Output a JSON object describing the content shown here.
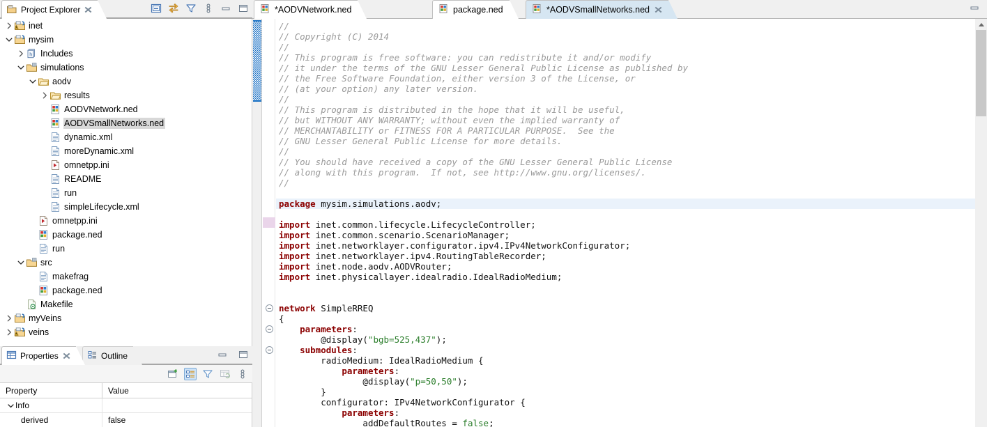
{
  "project_explorer": {
    "tab_label": "Project Explorer",
    "icon": "project-explorer-icon",
    "toolbar": [
      {
        "name": "collapse-all-icon",
        "tooltip": "Collapse All"
      },
      {
        "name": "link-with-editor-icon",
        "tooltip": "Link with Editor"
      },
      {
        "name": "filter-icon",
        "tooltip": "Filters"
      },
      {
        "name": "view-menu-icon",
        "tooltip": "View Menu"
      },
      {
        "name": "minimize-icon",
        "tooltip": "Minimize"
      },
      {
        "name": "maximize-icon",
        "tooltip": "Maximize"
      }
    ],
    "tree": [
      {
        "label": "inet",
        "indent": 0,
        "arrow": "collapsed",
        "icon": "project-warning-icon",
        "selected": false
      },
      {
        "label": "mysim",
        "indent": 0,
        "arrow": "expanded",
        "icon": "project-icon",
        "selected": false
      },
      {
        "label": "Includes",
        "indent": 1,
        "arrow": "collapsed",
        "icon": "includes-icon",
        "selected": false
      },
      {
        "label": "simulations",
        "indent": 1,
        "arrow": "expanded",
        "icon": "source-folder-icon",
        "selected": false
      },
      {
        "label": "aodv",
        "indent": 2,
        "arrow": "expanded",
        "icon": "folder-icon",
        "selected": false
      },
      {
        "label": "results",
        "indent": 3,
        "arrow": "collapsed",
        "icon": "folder-icon",
        "selected": false
      },
      {
        "label": "AODVNetwork.ned",
        "indent": 3,
        "arrow": "none",
        "icon": "ned-file-icon",
        "selected": false
      },
      {
        "label": "AODVSmallNetworks.ned",
        "indent": 3,
        "arrow": "none",
        "icon": "ned-file-icon",
        "selected": true
      },
      {
        "label": "dynamic.xml",
        "indent": 3,
        "arrow": "none",
        "icon": "xml-file-icon",
        "selected": false
      },
      {
        "label": "moreDynamic.xml",
        "indent": 3,
        "arrow": "none",
        "icon": "xml-file-icon",
        "selected": false
      },
      {
        "label": "omnetpp.ini",
        "indent": 3,
        "arrow": "none",
        "icon": "ini-file-icon",
        "selected": false
      },
      {
        "label": "README",
        "indent": 3,
        "arrow": "none",
        "icon": "text-file-icon",
        "selected": false
      },
      {
        "label": "run",
        "indent": 3,
        "arrow": "none",
        "icon": "text-file-icon",
        "selected": false
      },
      {
        "label": "simpleLifecycle.xml",
        "indent": 3,
        "arrow": "none",
        "icon": "xml-file-icon",
        "selected": false
      },
      {
        "label": "omnetpp.ini",
        "indent": 2,
        "arrow": "none",
        "icon": "ini-file-icon",
        "selected": false
      },
      {
        "label": "package.ned",
        "indent": 2,
        "arrow": "none",
        "icon": "ned-file-icon",
        "selected": false
      },
      {
        "label": "run",
        "indent": 2,
        "arrow": "none",
        "icon": "text-file-icon",
        "selected": false
      },
      {
        "label": "src",
        "indent": 1,
        "arrow": "expanded",
        "icon": "source-folder-icon",
        "selected": false
      },
      {
        "label": "makefrag",
        "indent": 2,
        "arrow": "none",
        "icon": "text-file-icon",
        "selected": false
      },
      {
        "label": "package.ned",
        "indent": 2,
        "arrow": "none",
        "icon": "ned-file-icon",
        "selected": false
      },
      {
        "label": "Makefile",
        "indent": 1,
        "arrow": "none",
        "icon": "makefile-icon",
        "selected": false
      },
      {
        "label": "myVeins",
        "indent": 0,
        "arrow": "collapsed",
        "icon": "project-icon",
        "selected": false
      },
      {
        "label": "veins",
        "indent": 0,
        "arrow": "collapsed",
        "icon": "project-warning-icon",
        "selected": false
      }
    ]
  },
  "properties_view": {
    "tabs": [
      {
        "label": "Properties",
        "icon": "properties-icon",
        "active": true,
        "closable": true
      },
      {
        "label": "Outline",
        "icon": "outline-icon",
        "active": false,
        "closable": false
      }
    ],
    "toolbar": [
      {
        "name": "new-property-icon",
        "selected": false
      },
      {
        "name": "show-categories-icon",
        "selected": true
      },
      {
        "name": "filter-icon",
        "selected": false
      },
      {
        "name": "restore-default-icon",
        "selected": false
      },
      {
        "name": "view-menu-icon",
        "selected": false
      }
    ],
    "window_buttons": [
      {
        "name": "minimize-icon"
      },
      {
        "name": "maximize-icon"
      }
    ],
    "columns": [
      "Property",
      "Value"
    ],
    "rows": [
      {
        "property": "Info",
        "value": "",
        "group": true,
        "expanded": true
      },
      {
        "property": "derived",
        "value": "false",
        "group": false
      }
    ]
  },
  "editor": {
    "tabs": [
      {
        "label": "*AODVNetwork.ned",
        "icon": "ned-file-icon",
        "active": false,
        "closable": false,
        "dirty": true
      },
      {
        "label": "package.ned",
        "icon": "ned-file-icon",
        "active": false,
        "closable": false,
        "dirty": false
      },
      {
        "label": "*AODVSmallNetworks.ned",
        "icon": "ned-file-icon",
        "active": true,
        "closable": true,
        "dirty": true
      }
    ],
    "window_buttons": [
      {
        "name": "minimize-icon"
      }
    ],
    "scrollbar": {
      "name": "editor-vertical-scrollbar",
      "thumb_top_pct": 3,
      "thumb_height_pct": 21
    },
    "code_lines": [
      {
        "indent": 0,
        "tokens": [
          {
            "t": "//",
            "c": "cmt"
          }
        ],
        "fold": null,
        "highlight": false
      },
      {
        "indent": 0,
        "tokens": [
          {
            "t": "// Copyright (C) 2014",
            "c": "cmt"
          }
        ],
        "fold": null,
        "highlight": false
      },
      {
        "indent": 0,
        "tokens": [
          {
            "t": "//",
            "c": "cmt"
          }
        ],
        "fold": null,
        "highlight": false
      },
      {
        "indent": 0,
        "tokens": [
          {
            "t": "// This program is free software: you can redistribute it and/or modify",
            "c": "cmt"
          }
        ],
        "fold": null,
        "highlight": false
      },
      {
        "indent": 0,
        "tokens": [
          {
            "t": "// it under the terms of the GNU Lesser General Public License as published by",
            "c": "cmt"
          }
        ],
        "fold": null,
        "highlight": false
      },
      {
        "indent": 0,
        "tokens": [
          {
            "t": "// the Free Software Foundation, either version 3 of the License, or",
            "c": "cmt"
          }
        ],
        "fold": null,
        "highlight": false
      },
      {
        "indent": 0,
        "tokens": [
          {
            "t": "// (at your option) any later version.",
            "c": "cmt"
          }
        ],
        "fold": null,
        "highlight": false
      },
      {
        "indent": 0,
        "tokens": [
          {
            "t": "//",
            "c": "cmt"
          }
        ],
        "fold": null,
        "highlight": false
      },
      {
        "indent": 0,
        "tokens": [
          {
            "t": "// This program is distributed in the hope that it will be useful,",
            "c": "cmt"
          }
        ],
        "fold": null,
        "highlight": false
      },
      {
        "indent": 0,
        "tokens": [
          {
            "t": "// but WITHOUT ANY WARRANTY; without even the implied warranty of",
            "c": "cmt"
          }
        ],
        "fold": null,
        "highlight": false
      },
      {
        "indent": 0,
        "tokens": [
          {
            "t": "// MERCHANTABILITY or FITNESS FOR A PARTICULAR PURPOSE.  See the",
            "c": "cmt"
          }
        ],
        "fold": null,
        "highlight": false
      },
      {
        "indent": 0,
        "tokens": [
          {
            "t": "// GNU Lesser General Public License for more details.",
            "c": "cmt"
          }
        ],
        "fold": null,
        "highlight": false
      },
      {
        "indent": 0,
        "tokens": [
          {
            "t": "//",
            "c": "cmt"
          }
        ],
        "fold": null,
        "highlight": false
      },
      {
        "indent": 0,
        "tokens": [
          {
            "t": "// You should have received a copy of the GNU Lesser General Public License",
            "c": "cmt"
          }
        ],
        "fold": null,
        "highlight": false
      },
      {
        "indent": 0,
        "tokens": [
          {
            "t": "// along with this program.  If not, see http://www.gnu.org/licenses/.",
            "c": "cmt"
          }
        ],
        "fold": null,
        "highlight": false
      },
      {
        "indent": 0,
        "tokens": [
          {
            "t": "//",
            "c": "cmt"
          }
        ],
        "fold": null,
        "highlight": false
      },
      {
        "indent": 0,
        "tokens": [],
        "fold": null,
        "highlight": false
      },
      {
        "indent": 0,
        "tokens": [
          {
            "t": "package",
            "c": "kw"
          },
          {
            "t": " mysim.simulations.aodv;",
            "c": "pln"
          }
        ],
        "fold": null,
        "highlight": true
      },
      {
        "indent": 0,
        "tokens": [],
        "fold": null,
        "highlight": false
      },
      {
        "indent": 0,
        "tokens": [
          {
            "t": "import",
            "c": "kw"
          },
          {
            "t": " inet.common.lifecycle.LifecycleController;",
            "c": "pln"
          }
        ],
        "fold": null,
        "highlight": false
      },
      {
        "indent": 0,
        "tokens": [
          {
            "t": "import",
            "c": "kw"
          },
          {
            "t": " inet.common.scenario.ScenarioManager;",
            "c": "pln"
          }
        ],
        "fold": null,
        "highlight": false
      },
      {
        "indent": 0,
        "tokens": [
          {
            "t": "import",
            "c": "kw"
          },
          {
            "t": " inet.networklayer.configurator.ipv4.IPv4NetworkConfigurator;",
            "c": "pln"
          }
        ],
        "fold": null,
        "highlight": false
      },
      {
        "indent": 0,
        "tokens": [
          {
            "t": "import",
            "c": "kw"
          },
          {
            "t": " inet.networklayer.ipv4.RoutingTableRecorder;",
            "c": "pln"
          }
        ],
        "fold": null,
        "highlight": false
      },
      {
        "indent": 0,
        "tokens": [
          {
            "t": "import",
            "c": "kw"
          },
          {
            "t": " inet.node.aodv.AODVRouter;",
            "c": "pln"
          }
        ],
        "fold": null,
        "highlight": false
      },
      {
        "indent": 0,
        "tokens": [
          {
            "t": "import",
            "c": "kw"
          },
          {
            "t": " inet.physicallayer.idealradio.IdealRadioMedium;",
            "c": "pln"
          }
        ],
        "fold": null,
        "highlight": false
      },
      {
        "indent": 0,
        "tokens": [],
        "fold": null,
        "highlight": false
      },
      {
        "indent": 0,
        "tokens": [],
        "fold": null,
        "highlight": false
      },
      {
        "indent": 0,
        "tokens": [
          {
            "t": "network",
            "c": "kw"
          },
          {
            "t": " SimpleRREQ",
            "c": "pln"
          }
        ],
        "fold": "collapse",
        "highlight": false
      },
      {
        "indent": 0,
        "tokens": [
          {
            "t": "{",
            "c": "pln"
          }
        ],
        "fold": null,
        "highlight": false
      },
      {
        "indent": 1,
        "tokens": [
          {
            "t": "parameters",
            "c": "kw"
          },
          {
            "t": ":",
            "c": "pln"
          }
        ],
        "fold": "collapse",
        "highlight": false
      },
      {
        "indent": 2,
        "tokens": [
          {
            "t": "@display(",
            "c": "pln"
          },
          {
            "t": "\"bgb=525,437\"",
            "c": "str"
          },
          {
            "t": ");",
            "c": "pln"
          }
        ],
        "fold": null,
        "highlight": false
      },
      {
        "indent": 1,
        "tokens": [
          {
            "t": "submodules",
            "c": "kw"
          },
          {
            "t": ":",
            "c": "pln"
          }
        ],
        "fold": "collapse",
        "highlight": false
      },
      {
        "indent": 2,
        "tokens": [
          {
            "t": "radioMedium: IdealRadioMedium {",
            "c": "pln"
          }
        ],
        "fold": null,
        "highlight": false
      },
      {
        "indent": 3,
        "tokens": [
          {
            "t": "parameters",
            "c": "kw"
          },
          {
            "t": ":",
            "c": "pln"
          }
        ],
        "fold": null,
        "highlight": false
      },
      {
        "indent": 4,
        "tokens": [
          {
            "t": "@display(",
            "c": "pln"
          },
          {
            "t": "\"p=50,50\"",
            "c": "str"
          },
          {
            "t": ");",
            "c": "pln"
          }
        ],
        "fold": null,
        "highlight": false
      },
      {
        "indent": 2,
        "tokens": [
          {
            "t": "}",
            "c": "pln"
          }
        ],
        "fold": null,
        "highlight": false
      },
      {
        "indent": 2,
        "tokens": [
          {
            "t": "configurator: IPv4NetworkConfigurator {",
            "c": "pln"
          }
        ],
        "fold": null,
        "highlight": false
      },
      {
        "indent": 3,
        "tokens": [
          {
            "t": "parameters",
            "c": "kw"
          },
          {
            "t": ":",
            "c": "pln"
          }
        ],
        "fold": null,
        "highlight": false
      },
      {
        "indent": 4,
        "tokens": [
          {
            "t": "addDefaultRoutes = ",
            "c": "pln"
          },
          {
            "t": "false",
            "c": "str"
          },
          {
            "t": ";",
            "c": "pln"
          }
        ],
        "fold": null,
        "highlight": false
      }
    ]
  },
  "colors": {
    "selection_bg": "#d8d8d8",
    "active_tab_bg": "#d6e6f2",
    "highlight_line": "#eaf2fb",
    "comment": "#9a9a9a",
    "keyword": "#8b0000",
    "string": "#2a7d2a",
    "marker_blue": "#1c72c4"
  }
}
